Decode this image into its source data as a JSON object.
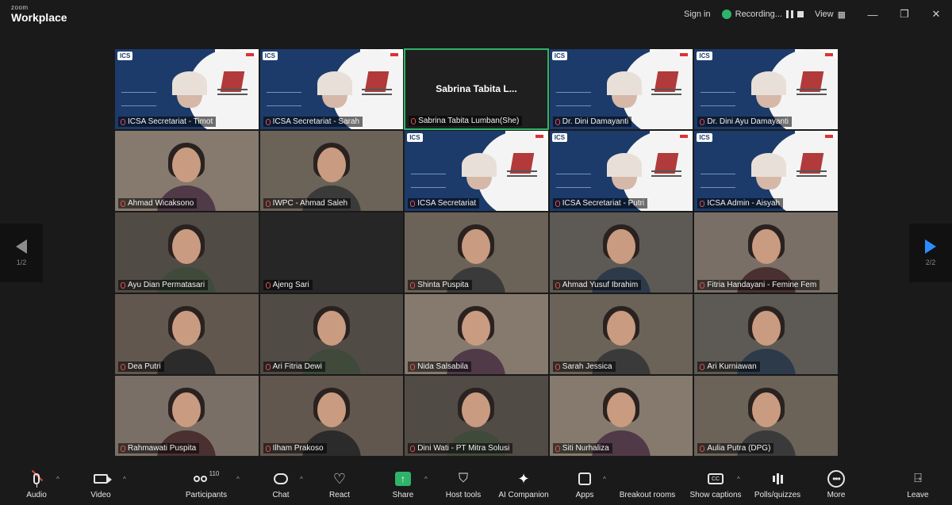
{
  "app": {
    "brand_small": "zoom",
    "brand_big": "Workplace"
  },
  "topbar": {
    "sign_in": "Sign in",
    "recording": "Recording...",
    "view": "View",
    "minimize": "—",
    "restore": "❐",
    "close": "✕"
  },
  "nav": {
    "left_page": "1/2",
    "right_page": "2/2"
  },
  "tiles": [
    {
      "name": "ICSA Secretariat - Timot",
      "kind": "slide"
    },
    {
      "name": "ICSA Secretariat - Sarah",
      "kind": "slide"
    },
    {
      "name": "Sabrina Tabita Lumban(She)",
      "kind": "name",
      "center": "Sabrina Tabita L...",
      "active": true
    },
    {
      "name": "Dr. Dini Damayanti",
      "kind": "slide"
    },
    {
      "name": "Dr. Dini Ayu Damayanti",
      "kind": "slide"
    },
    {
      "name": "Ahmad Wicaksono",
      "kind": "cam"
    },
    {
      "name": "IWPC - Ahmad Saleh",
      "kind": "cam"
    },
    {
      "name": "ICSA Secretariat",
      "kind": "slide"
    },
    {
      "name": "ICSA Secretariat - Putri",
      "kind": "slide"
    },
    {
      "name": "ICSA Admin - Aisyah",
      "kind": "slide"
    },
    {
      "name": "Ayu Dian Permatasari",
      "kind": "cam"
    },
    {
      "name": "Ajeng Sari",
      "kind": "dark"
    },
    {
      "name": "Shinta Puspita",
      "kind": "cam"
    },
    {
      "name": "Ahmad Yusuf Ibrahim",
      "kind": "cam"
    },
    {
      "name": "Fitria Handayani - Femine Fem",
      "kind": "cam"
    },
    {
      "name": "Dea Putri",
      "kind": "cam"
    },
    {
      "name": "Ari Fitria Dewi",
      "kind": "cam"
    },
    {
      "name": "Nida Salsabila",
      "kind": "cam"
    },
    {
      "name": "Sarah Jessica",
      "kind": "cam"
    },
    {
      "name": "Ari Kurniawan",
      "kind": "cam"
    },
    {
      "name": "Rahmawati Puspita",
      "kind": "cam"
    },
    {
      "name": "Ilham Prakoso",
      "kind": "cam"
    },
    {
      "name": "Dini Wati - PT Mitra Solusi",
      "kind": "cam"
    },
    {
      "name": "Siti Nurhaliza",
      "kind": "cam"
    },
    {
      "name": "Aulia Putra (DPG)",
      "kind": "cam"
    }
  ],
  "toolbar": {
    "audio": "Audio",
    "video": "Video",
    "participants": "Participants",
    "participants_count": "110",
    "chat": "Chat",
    "react": "React",
    "share": "Share",
    "host_tools": "Host tools",
    "ai_companion": "AI Companion",
    "apps": "Apps",
    "breakout_rooms": "Breakout rooms",
    "show_captions": "Show captions",
    "polls_quizzes": "Polls/quizzes",
    "more": "More",
    "leave": "Leave"
  },
  "colors": {
    "background": "#1a1a1a",
    "active_speaker": "#2fb36a",
    "next_page": "#2d8cff",
    "slide_blue": "#1c3b6b"
  }
}
